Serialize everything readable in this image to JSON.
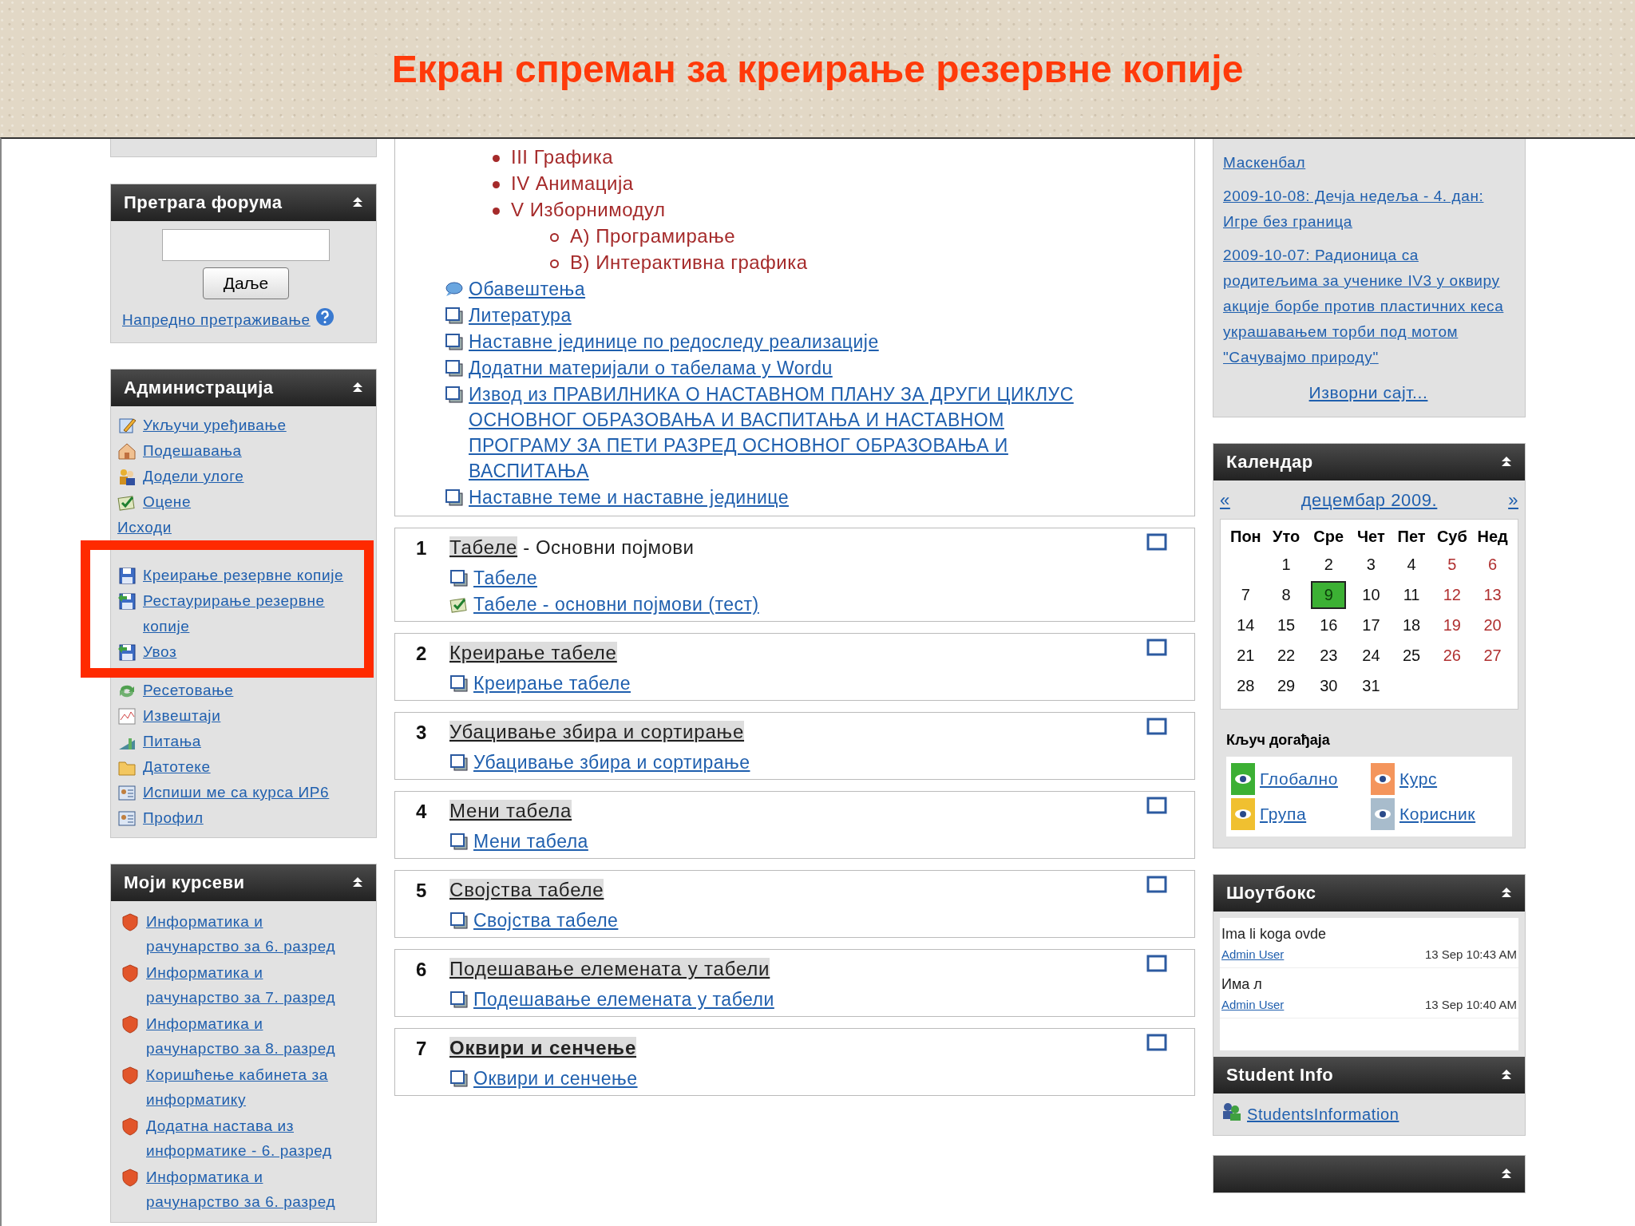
{
  "slide_title": "Екран спреман за креирање резервне копије",
  "forum_search": {
    "title": "Претрага форума",
    "button": "Даље",
    "advanced_link": "Напредно претраживање"
  },
  "administration": {
    "title": "Администрација",
    "items": [
      {
        "label": "Укључи уређивање",
        "kind": "edit",
        "highlighted": false
      },
      {
        "label": "Подешавања",
        "kind": "settings",
        "highlighted": false
      },
      {
        "label": "Додели улоге",
        "kind": "roles",
        "highlighted": false
      },
      {
        "label": "Оцене",
        "kind": "grades",
        "highlighted": false
      },
      {
        "label": "Исходи",
        "kind": "plain",
        "highlighted": false
      },
      {
        "label": "Креирање резервне копије",
        "kind": "backup",
        "highlighted": true
      },
      {
        "label": "Рестаурирање резервне копије",
        "kind": "restore",
        "highlighted": true
      },
      {
        "label": "Увоз",
        "kind": "import",
        "highlighted": true
      },
      {
        "label": "Ресетовање",
        "kind": "reset",
        "highlighted": false
      },
      {
        "label": "Извештаји",
        "kind": "reports",
        "highlighted": false
      },
      {
        "label": "Питања",
        "kind": "questions",
        "highlighted": false
      },
      {
        "label": "Датотеке",
        "kind": "files",
        "highlighted": false
      },
      {
        "label": "Испиши ме са курса ИР6",
        "kind": "unenrol",
        "highlighted": false
      },
      {
        "label": "Профил",
        "kind": "profile",
        "highlighted": false
      }
    ]
  },
  "my_courses": {
    "title": "Моји курсеви",
    "items": [
      "Информатика и рачунарство за 6. разред",
      "Информатика и рачунарство за 7. разред",
      "Информатика и рачунарство за 8. разред",
      "Коришћење кабинета за информатику",
      "Додатна настава из информатике - 6. разред",
      "Информатика и рачунарство за 6. разред"
    ]
  },
  "topic_outline": {
    "bullets": [
      {
        "text": "III Графика"
      },
      {
        "text": "IV Анимација"
      },
      {
        "text": "V Изборнимодул",
        "children": [
          {
            "text": "A) Програмирање"
          },
          {
            "text": "B) Интерактивна графика"
          }
        ]
      }
    ],
    "resources": [
      {
        "kind": "forum",
        "label": "Обавештења"
      },
      {
        "kind": "page",
        "label": "Литература"
      },
      {
        "kind": "page",
        "label": "Наставне јединице по редоследу реализације"
      },
      {
        "kind": "page",
        "label": "Додатни материјали о табелама у Wordu"
      },
      {
        "kind": "page",
        "label": "Извод из ПРАВИЛНИКА О НАСТАВНОМ ПЛАНУ ЗА ДРУГИ ЦИКЛУС ОСНОВНОГ ОБРАЗОВАЊА И ВАСПИТАЊА И НАСТАВНОМ ПРОГРАМУ ЗА ПЕТИ РАЗРЕД ОСНОВНОГ ОБРАЗОВАЊА И ВАСПИТАЊА"
      },
      {
        "kind": "page",
        "label": "Наставне теме и наставне јединице"
      }
    ]
  },
  "sections": [
    {
      "number": "1",
      "title": "Табеле",
      "subtitle": " - Основни појмови",
      "bold": false,
      "resources": [
        {
          "kind": "page",
          "label": "Табеле"
        },
        {
          "kind": "quiz",
          "label": "Табеле - основни појмови (тест)"
        }
      ]
    },
    {
      "number": "2",
      "title": "Креирање табеле",
      "bold": false,
      "resources": [
        {
          "kind": "page",
          "label": "Креирање табеле"
        }
      ]
    },
    {
      "number": "3",
      "title": "Убацивање збира и сортирање",
      "bold": false,
      "resources": [
        {
          "kind": "page",
          "label": "Убацивање збира и сортирање"
        }
      ]
    },
    {
      "number": "4",
      "title": "Мени табела",
      "bold": false,
      "resources": [
        {
          "kind": "page",
          "label": "Мени табела"
        }
      ]
    },
    {
      "number": "5",
      "title": "Својства табеле",
      "bold": false,
      "resources": [
        {
          "kind": "page",
          "label": "Својства табеле"
        }
      ]
    },
    {
      "number": "6",
      "title": "Подешавање елемената у табели",
      "bold": false,
      "resources": [
        {
          "kind": "page",
          "label": "Подешавање елемената у табели"
        }
      ]
    },
    {
      "number": "7",
      "title": "Оквири и сенчење",
      "bold": true,
      "resources": [
        {
          "kind": "page",
          "label": "Оквири и сенчење"
        }
      ]
    }
  ],
  "news": {
    "items": [
      "Маскенбал",
      "2009-10-08: Дечја недеља - 4. дан: Игре без граница",
      "2009-10-07: Радионица са родитељима за ученике IV3 у оквиру акције борбе против пластичних кеса украшавањем торби под мотом \"Сачувајмо природу\""
    ],
    "source_link": "Изворни сајт..."
  },
  "calendar": {
    "title": "Календар",
    "prev": "«",
    "month": "децембар 2009.",
    "next": "»",
    "weekdays": [
      "Пон",
      "Уто",
      "Сре",
      "Чет",
      "Пет",
      "Суб",
      "Нед"
    ],
    "weeks": [
      [
        {
          "day": "1",
          "weekend": false,
          "selected": false
        },
        {
          "day": "2",
          "weekend": false,
          "selected": false
        },
        {
          "day": "3",
          "weekend": false,
          "selected": false
        },
        {
          "day": "4",
          "weekend": false,
          "selected": false
        },
        {
          "day": "5",
          "weekend": true,
          "selected": false
        },
        {
          "day": "6",
          "weekend": true,
          "selected": false
        }
      ],
      [
        {
          "day": "7",
          "weekend": false,
          "selected": false
        },
        {
          "day": "8",
          "weekend": false,
          "selected": false
        },
        {
          "day": "9",
          "weekend": false,
          "selected": true
        },
        {
          "day": "10",
          "weekend": false,
          "selected": false
        },
        {
          "day": "11",
          "weekend": false,
          "selected": false
        },
        {
          "day": "12",
          "weekend": true,
          "selected": false
        },
        {
          "day": "13",
          "weekend": true,
          "selected": false
        }
      ],
      [
        {
          "day": "14",
          "weekend": false,
          "selected": false
        },
        {
          "day": "15",
          "weekend": false,
          "selected": false
        },
        {
          "day": "16",
          "weekend": false,
          "selected": false
        },
        {
          "day": "17",
          "weekend": false,
          "selected": false
        },
        {
          "day": "18",
          "weekend": false,
          "selected": false
        },
        {
          "day": "19",
          "weekend": true,
          "selected": false
        },
        {
          "day": "20",
          "weekend": true,
          "selected": false
        }
      ],
      [
        {
          "day": "21",
          "weekend": false,
          "selected": false
        },
        {
          "day": "22",
          "weekend": false,
          "selected": false
        },
        {
          "day": "23",
          "weekend": false,
          "selected": false
        },
        {
          "day": "24",
          "weekend": false,
          "selected": false
        },
        {
          "day": "25",
          "weekend": false,
          "selected": false
        },
        {
          "day": "26",
          "weekend": true,
          "selected": false
        },
        {
          "day": "27",
          "weekend": true,
          "selected": false
        }
      ],
      [
        {
          "day": "28",
          "weekend": false,
          "selected": false
        },
        {
          "day": "29",
          "weekend": false,
          "selected": false
        },
        {
          "day": "30",
          "weekend": false,
          "selected": false
        },
        {
          "day": "31",
          "weekend": false,
          "selected": false
        }
      ]
    ],
    "key_title": "Кључ догађаја",
    "key": [
      {
        "label": "Глобално",
        "color": "#3cb034"
      },
      {
        "label": "Курс",
        "color": "#f4955c"
      },
      {
        "label": "Група",
        "color": "#f0c030"
      },
      {
        "label": "Корисник",
        "color": "#a8bccc"
      }
    ]
  },
  "shoutbox": {
    "title": "Шоутбокс",
    "messages": [
      {
        "text": "Ima li koga ovde",
        "author": "Admin User",
        "time": "13 Sep 10:43 AM"
      },
      {
        "text": "Има л",
        "author": "Admin User",
        "time": "13 Sep 10:40 AM"
      }
    ]
  },
  "student_info": {
    "title": "Student Info",
    "link": "StudentsInformation"
  }
}
